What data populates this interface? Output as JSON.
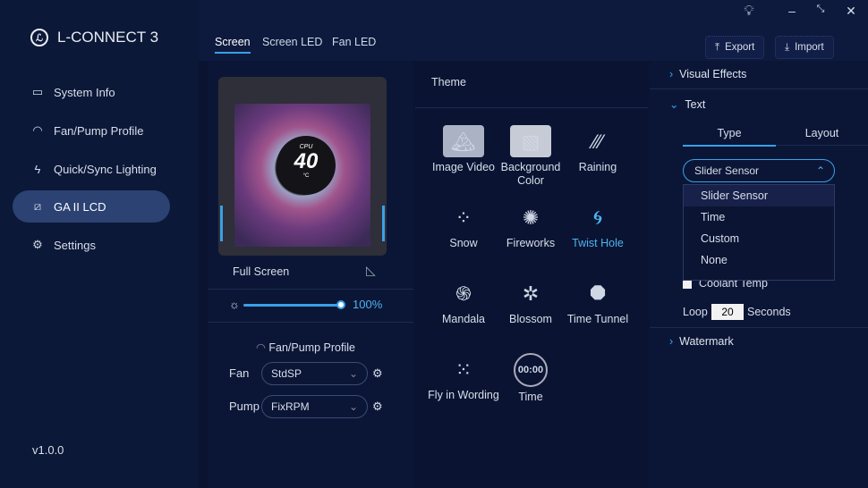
{
  "app": {
    "title": "L-CONNECT 3",
    "version": "v1.0.0"
  },
  "sidebar": {
    "items": [
      {
        "label": "System Info",
        "icon": "monitor-icon"
      },
      {
        "label": "Fan/Pump Profile",
        "icon": "gauge-icon"
      },
      {
        "label": "Quick/Sync Lighting",
        "icon": "lightning-icon"
      },
      {
        "label": "GA II LCD",
        "icon": "lcd-icon",
        "active": true
      },
      {
        "label": "Settings",
        "icon": "gear-icon"
      }
    ]
  },
  "header": {
    "tabs": [
      "Screen",
      "Screen LED",
      "Fan LED"
    ],
    "active_tab": "Screen",
    "export": "Export",
    "import": "Import"
  },
  "preview": {
    "screen_label": "CPU",
    "screen_value": "40",
    "screen_unit": "°C",
    "mode": "Full Screen",
    "brightness": "100%",
    "brightness_value": 100
  },
  "fan_pump": {
    "title": "Fan/Pump Profile",
    "fan_label": "Fan",
    "fan_value": "StdSP",
    "pump_label": "Pump",
    "pump_value": "FixRPM"
  },
  "theme": {
    "title": "Theme",
    "items": [
      {
        "label": "Image Video"
      },
      {
        "label": "Background Color"
      },
      {
        "label": "Raining"
      },
      {
        "label": "Snow"
      },
      {
        "label": "Fireworks"
      },
      {
        "label": "Twist Hole",
        "selected": true
      },
      {
        "label": "Mandala"
      },
      {
        "label": "Blossom"
      },
      {
        "label": "Time Tunnel"
      },
      {
        "label": "Fly in Wording"
      },
      {
        "label": "Time",
        "icon_text": "00:00"
      }
    ]
  },
  "settings": {
    "visual_effects": "Visual Effects",
    "text": "Text",
    "tabs": [
      "Type",
      "Layout"
    ],
    "type_value": "Slider Sensor",
    "options": [
      "Slider Sensor",
      "Time",
      "Custom",
      "None"
    ],
    "coolant": "Coolant Temp",
    "loop_label": "Loop",
    "loop_value": "20",
    "seconds": "Seconds",
    "watermark": "Watermark"
  },
  "colors": {
    "accent": "#3aa0e8",
    "selected_theme": "#4fb3f0"
  }
}
